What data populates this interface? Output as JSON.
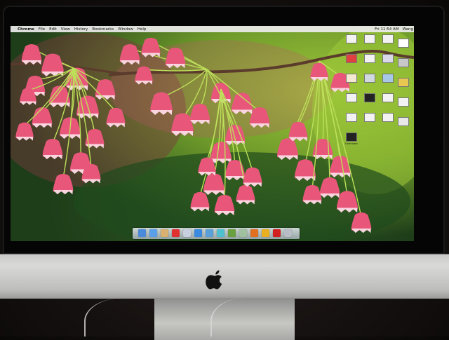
{
  "menubar": {
    "apple_glyph": "",
    "app_name": "Chrome",
    "items": [
      "File",
      "Edit",
      "View",
      "History",
      "Bookmarks",
      "Window",
      "Help"
    ],
    "right_items": [
      "Fri 11:54 AM",
      "Wang"
    ]
  },
  "desktop_icons": [
    {
      "label": "",
      "color": "#f2f2f2"
    },
    {
      "label": "",
      "color": "#f2f2f2"
    },
    {
      "label": "",
      "color": "#f2f2f2"
    },
    {
      "label": "",
      "color": "#ffffff"
    },
    {
      "label": "",
      "color": "#e04040"
    },
    {
      "label": "",
      "color": "#f2f2f2"
    },
    {
      "label": "",
      "color": "#d8d8e8"
    },
    {
      "label": "",
      "color": "#c8c8c8"
    },
    {
      "label": "",
      "color": "#f4e8d0"
    },
    {
      "label": "",
      "color": "#d0d8e0"
    },
    {
      "label": "",
      "color": "#a8c8e8"
    },
    {
      "label": "",
      "color": "#e8c850"
    },
    {
      "label": "",
      "color": "#f2f2f2"
    },
    {
      "label": "",
      "color": "#222222"
    },
    {
      "label": "",
      "color": "#f2f2f2"
    },
    {
      "label": "",
      "color": "#f2f2f2"
    },
    {
      "label": "",
      "color": "#f2f2f2"
    },
    {
      "label": "",
      "color": "#f2f2f2"
    },
    {
      "label": "",
      "color": "#f2f2f2"
    },
    {
      "label": "",
      "color": "#e8e8e8"
    },
    {
      "label": "Unknown",
      "color": "#222222"
    }
  ],
  "dock_apps": [
    {
      "icon": "finder-icon",
      "color": "#4a8ad8"
    },
    {
      "icon": "app-store-icon",
      "color": "#5aa0e8"
    },
    {
      "icon": "photos-icon",
      "color": "#d8b070"
    },
    {
      "icon": "book-icon",
      "color": "#e03030"
    },
    {
      "icon": "folder-icon",
      "color": "#c8d0e0"
    },
    {
      "icon": "safari-icon",
      "color": "#3a8ae0"
    },
    {
      "icon": "globe-icon",
      "color": "#5aa0d8"
    },
    {
      "icon": "kindle-icon",
      "color": "#50c0d0"
    },
    {
      "icon": "minecraft-icon",
      "color": "#6aa040"
    },
    {
      "icon": "app-icon",
      "color": "#a0c0a0"
    },
    {
      "icon": "firefox-icon",
      "color": "#e07020"
    },
    {
      "icon": "chrome-icon",
      "color": "#e8b020"
    },
    {
      "icon": "acrobat-icon",
      "color": "#d02020"
    },
    {
      "icon": "trash-icon",
      "color": "#b8bcc4"
    }
  ],
  "device": {
    "logo": "apple-logo"
  },
  "colors": {
    "flower": "#e8577a",
    "flower_light": "#f7d6df",
    "stem": "#bde05a",
    "branch": "#5a3b2c"
  }
}
